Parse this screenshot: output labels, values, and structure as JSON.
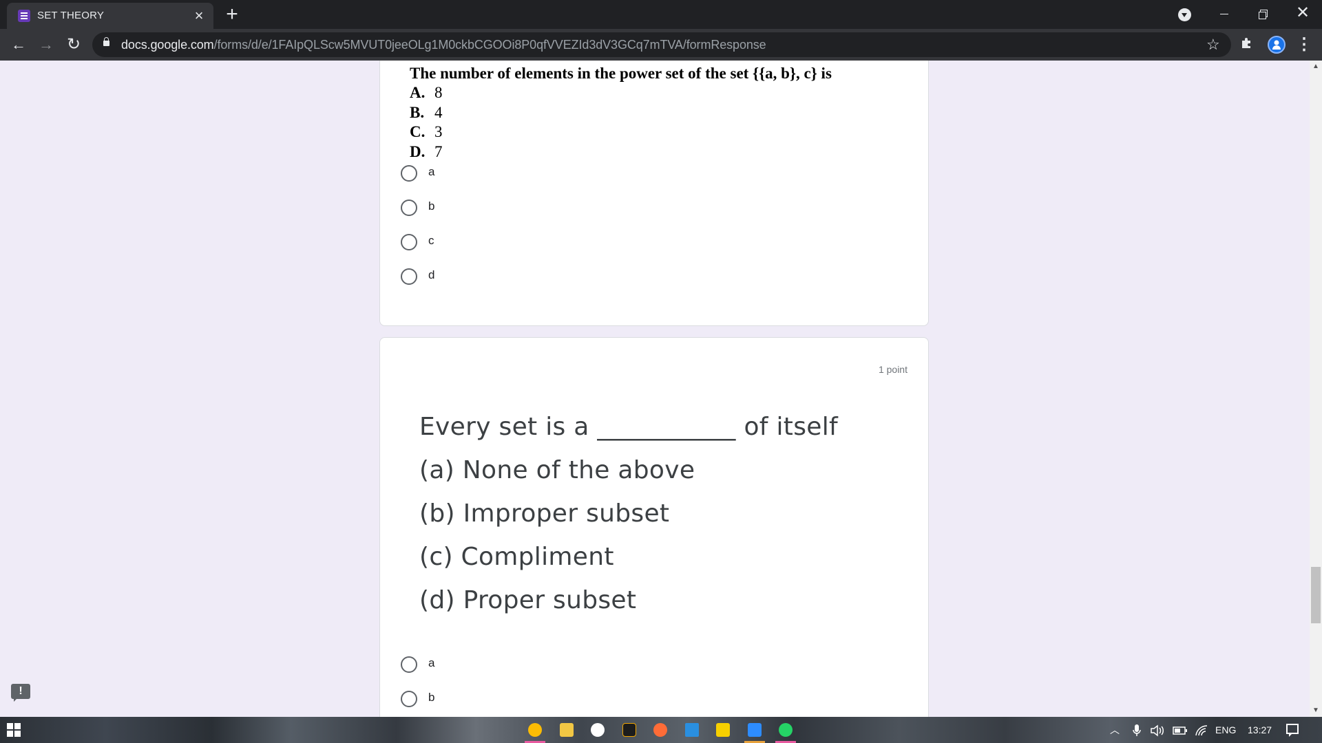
{
  "browser": {
    "tab_title": "SET THEORY",
    "tab_close": "×",
    "new_tab": "+",
    "url_host": "docs.google.com",
    "url_path": "/forms/d/e/1FAIpQLScw5MVUT0jeeOLg1M0ckbCGOOi8P0qfVVEZId3dV3GCq7mTVA/formResponse",
    "icons": {
      "back": "←",
      "forward": "→",
      "reload": "↻",
      "star": "☆",
      "extensions": "puzzle-icon",
      "menu": "⋮",
      "close": "✕"
    }
  },
  "question1": {
    "stem": "The number of elements in the power set of the set {{a, b}, c} is",
    "options": [
      {
        "letter": "A.",
        "value": "8"
      },
      {
        "letter": "B.",
        "value": "4"
      },
      {
        "letter": "C.",
        "value": "3"
      },
      {
        "letter": "D.",
        "value": "7"
      }
    ],
    "choices": [
      "a",
      "b",
      "c",
      "d"
    ]
  },
  "question2": {
    "points": "1 point",
    "lines": [
      "Every set is a ___________ of itself",
      "(a) None of the above",
      "(b) Improper subset",
      "(c) Compliment",
      "(d) Proper subset"
    ],
    "choices": [
      "a",
      "b"
    ]
  },
  "feedback": "!",
  "taskbar": {
    "language": "ENG",
    "time": "13:27",
    "apps": [
      {
        "name": "chrome",
        "color": "#fbbc04",
        "indicator": "#e85aa0"
      },
      {
        "name": "file-explorer",
        "color": "#f2c744",
        "indicator": ""
      },
      {
        "name": "upwork",
        "color": "#ffffff",
        "indicator": ""
      },
      {
        "name": "terminal",
        "color": "#1c1c1c",
        "indicator": ""
      },
      {
        "name": "postman",
        "color": "#ff6c37",
        "indicator": ""
      },
      {
        "name": "vscode",
        "color": "#2a8fe0",
        "indicator": ""
      },
      {
        "name": "sticky-notes",
        "color": "#f7d000",
        "indicator": ""
      },
      {
        "name": "zoom",
        "color": "#2d8cff",
        "indicator": "#e8a23c"
      },
      {
        "name": "whatsapp",
        "color": "#25d366",
        "indicator": "#e85aa0"
      }
    ]
  }
}
